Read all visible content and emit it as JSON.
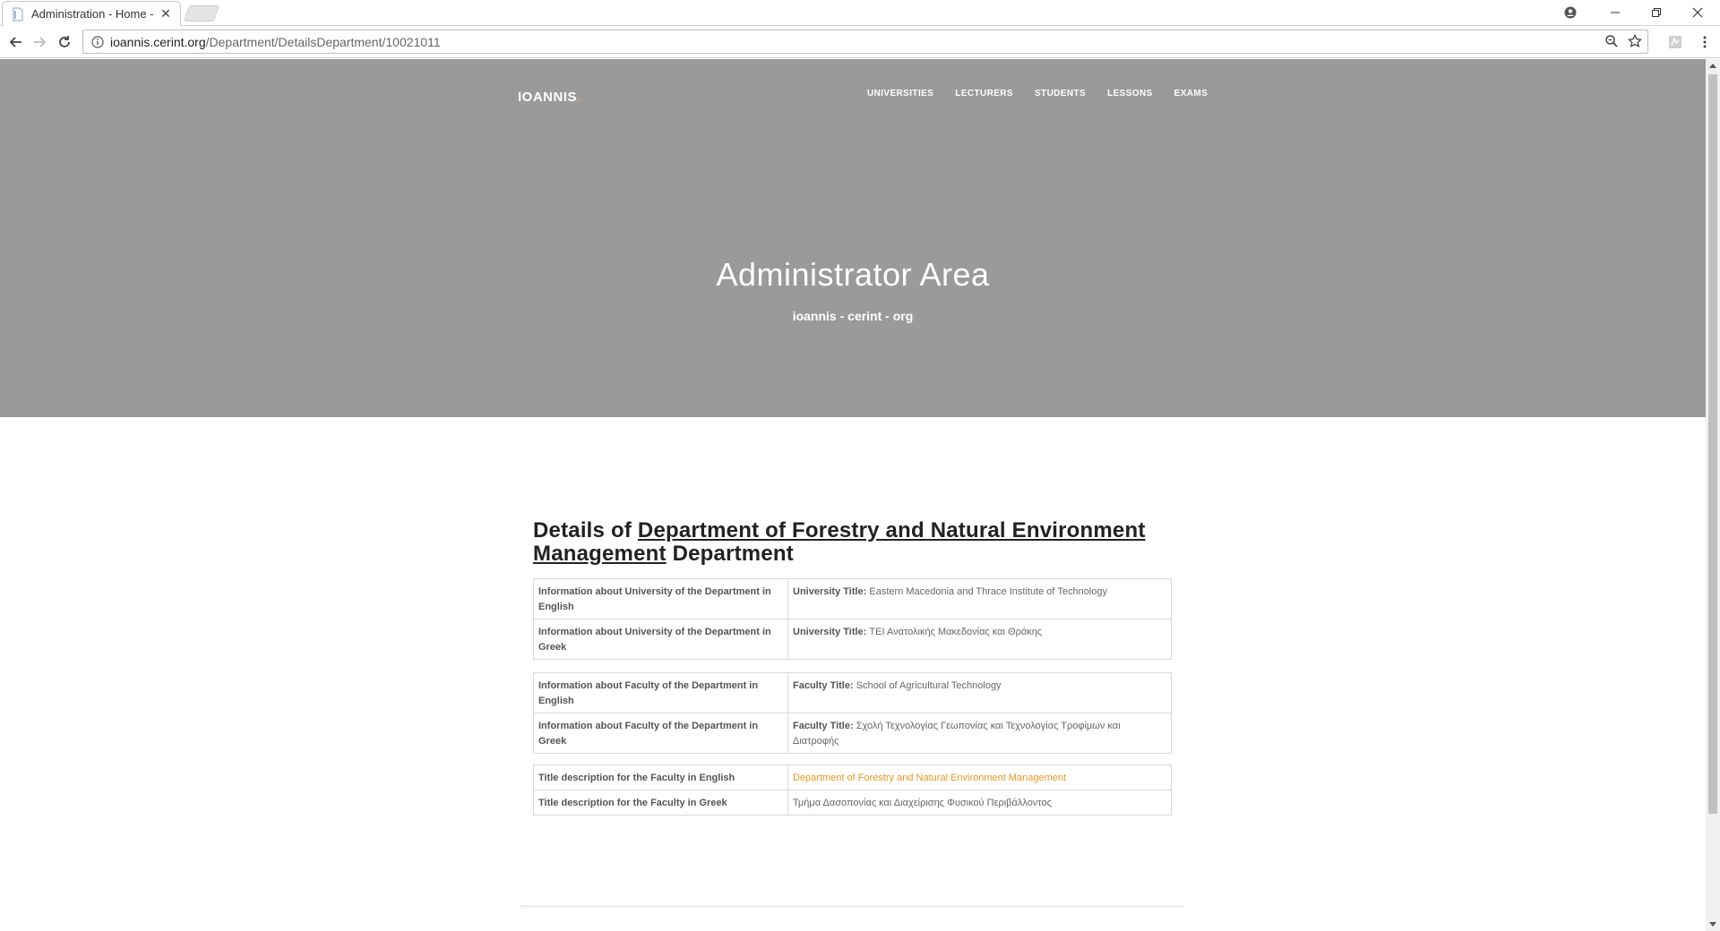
{
  "browser": {
    "tab_title": "Administration - Home -",
    "tab_close": "✕",
    "url_host": "ioannis.cerint.org",
    "url_path": "/Department/DetailsDepartment/10021011"
  },
  "site": {
    "brand": "IOANNIS",
    "brand_dot": ".",
    "nav": [
      "UNIVERSITIES",
      "LECTURERS",
      "STUDENTS",
      "LESSONS",
      "EXAMS"
    ],
    "hero_title": "Administrator Area",
    "hero_subtitle": "ioannis - cerint - org"
  },
  "details": {
    "prefix": "Details of",
    "department_link": "Department of Forestry and Natural Environment Management",
    "suffix": "Department",
    "university_rows": [
      {
        "label": "Information about University of the Department in English",
        "key": "University Title:",
        "value": "Eastern Macedonia and Thrace Institute of Technology"
      },
      {
        "label": "Information about University of the Department in Greek",
        "key": "University Title:",
        "value": "ΤΕΙ Ανατολικής Μακεδονίας και Θράκης"
      }
    ],
    "faculty_rows": [
      {
        "label": "Information about Faculty of the Department in English",
        "key": "Faculty Title:",
        "value": "School of Agricultural Technology"
      },
      {
        "label": "Information about Faculty of the Department in Greek",
        "key": "Faculty Title:",
        "value": "Σχολή Τεχνολογίας Γεωπονίας και Τεχνολογίας Τροφίμων και Διατροφής"
      }
    ],
    "title_rows": [
      {
        "label": "Title description for the Faculty in English",
        "value": "Department of Forestry and Natural Environment Management"
      },
      {
        "label": "Title description for the Faculty in Greek",
        "value": "Τμήμα Δασοπονίας και Διαχείρισης Φυσικού Περιβάλλοντος"
      }
    ]
  },
  "colors": {
    "hero_bg": "#9a9a9a",
    "accent_orange": "#e8961f"
  }
}
